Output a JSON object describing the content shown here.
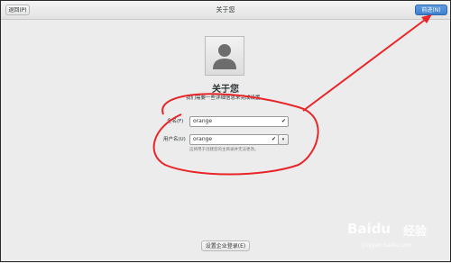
{
  "header": {
    "back_label": "退回(P)",
    "title": "关于您",
    "next_label": "前进(N)"
  },
  "main": {
    "title": "关于您",
    "subtitle": "我们需要一些详细信息来完成设置。",
    "fullname_label": "全名(F)",
    "fullname_value": "orange",
    "username_label": "用户名(U)",
    "username_value": "orange",
    "hint": "这将用于创建您的主目录并无法更改。"
  },
  "footer": {
    "enterprise_label": "设置企业登录(E)"
  },
  "watermark": {
    "brand": "Baidu",
    "text": "经验",
    "url": "jingyan.baidu.com"
  },
  "colors": {
    "annotation": "#e8262a",
    "primary_button": "#4a8ad6"
  }
}
